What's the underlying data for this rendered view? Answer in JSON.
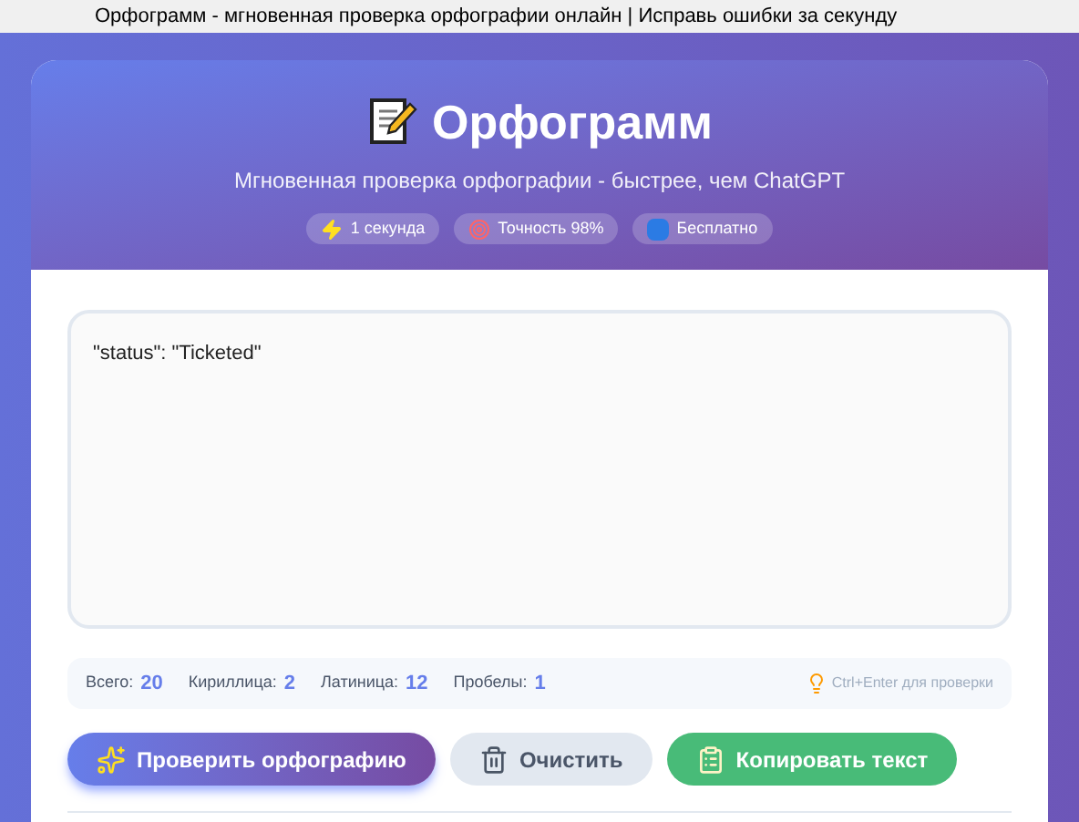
{
  "browser_tab": {
    "title": "Орфограмм - мгновенная проверка орфографии онлайн | Исправь ошибки за секунду"
  },
  "header": {
    "title": "Орфограмм",
    "subtitle": "Мгновенная проверка орфографии - быстрее, чем ChatGPT",
    "badges": [
      {
        "kind": "speed",
        "label": "1 секунда"
      },
      {
        "kind": "accuracy",
        "label": "Точность 98%"
      },
      {
        "kind": "free",
        "label": "Бесплатно"
      }
    ]
  },
  "editor": {
    "value": "\"status\": \"Ticketed\""
  },
  "stats": [
    {
      "label": "Всего:",
      "value": "20"
    },
    {
      "label": "Кириллица:",
      "value": "2"
    },
    {
      "label": "Латиница:",
      "value": "12"
    },
    {
      "label": "Пробелы:",
      "value": "1"
    }
  ],
  "hint": "Ctrl+Enter для проверки",
  "buttons": [
    {
      "kind": "primary",
      "label": "Проверить орфографию"
    },
    {
      "kind": "clear",
      "label": "Очистить"
    },
    {
      "kind": "copy",
      "label": "Копировать текст"
    }
  ]
}
